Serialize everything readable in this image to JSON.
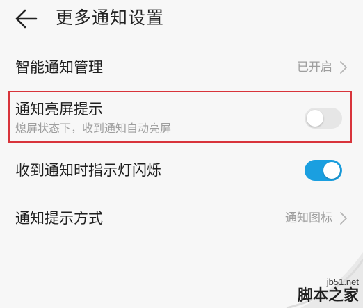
{
  "header": {
    "title": "更多通知设置",
    "back_icon": "arrow-left-icon"
  },
  "settings": [
    {
      "label": "智能通知管理",
      "value": "已开启",
      "control": "chevron-right-icon"
    },
    {
      "label": "通知亮屏提示",
      "sublabel": "熄屏状态下，收到通知自动亮屏",
      "toggle": "off",
      "highlighted": true
    },
    {
      "label": "收到通知时指示灯闪烁",
      "toggle": "on"
    },
    {
      "label": "通知提示方式",
      "value": "通知图标",
      "control": "chevron-right-icon"
    }
  ],
  "watermark": {
    "url": "jb51.net",
    "brand": "脚本之家"
  },
  "colors": {
    "background": "#f7f7f7",
    "toggle_on": "#1a9fe0",
    "toggle_off": "#e6e6e6",
    "highlight_border": "#d8343b",
    "secondary_text": "#9e9e9e"
  }
}
